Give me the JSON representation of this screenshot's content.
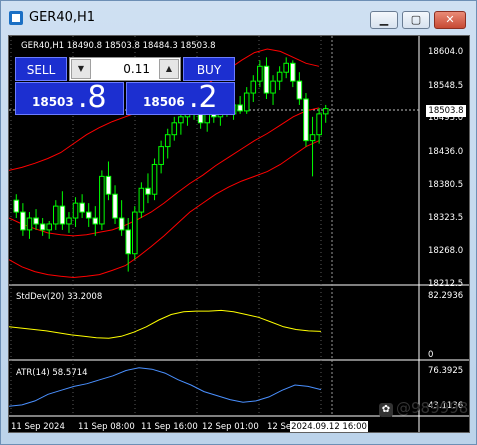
{
  "window": {
    "title": "GER40,H1",
    "minimize_icon": "minimize-icon",
    "restore_icon": "restore-icon",
    "close_icon": "close-icon"
  },
  "chart_header": "GER40,H1  18490.8 18503.8 18484.3 18503.8",
  "trading": {
    "sell_label": "SELL",
    "buy_label": "BUY",
    "lot": "0.11",
    "sell_price_main": "18503",
    "sell_price_big": ".8",
    "buy_price_main": "18506",
    "buy_price_big": ".2"
  },
  "price_axis": [
    "18604.0",
    "18548.5",
    "18493.0",
    "18436.0",
    "18380.5",
    "18323.5",
    "18268.0",
    "18212.5"
  ],
  "last_price": "18503.8",
  "stddev": {
    "label": "StdDev(20) 33.2008",
    "top": "82.2936",
    "bottom": "0"
  },
  "atr": {
    "label": "ATR(14) 58.5714",
    "top": "76.3925",
    "bottom": "43.1136"
  },
  "time_axis": [
    "11 Sep 2024",
    "11 Sep 08:00",
    "11 Sep 16:00",
    "12 Sep 01:00",
    "12 Se"
  ],
  "crosshair_time": "2024.09.12 16:00",
  "watermark": "@989998",
  "colors": {
    "candle": "#00ff00",
    "bands": "#ff0000",
    "stddev": "#ffff00",
    "atr": "#4a90ff",
    "panel_blue": "#1c2fd0"
  },
  "chart_data": [
    {
      "type": "candlestick",
      "title": "GER40,H1",
      "ylim": [
        18212.5,
        18604.0
      ],
      "candles": [
        [
          18350,
          18360,
          18320,
          18330
        ],
        [
          18330,
          18345,
          18290,
          18300
        ],
        [
          18300,
          18330,
          18285,
          18320
        ],
        [
          18320,
          18335,
          18300,
          18310
        ],
        [
          18310,
          18320,
          18290,
          18300
        ],
        [
          18300,
          18315,
          18285,
          18310
        ],
        [
          18310,
          18350,
          18300,
          18340
        ],
        [
          18340,
          18365,
          18300,
          18310
        ],
        [
          18310,
          18330,
          18295,
          18320
        ],
        [
          18320,
          18355,
          18305,
          18345
        ],
        [
          18345,
          18360,
          18320,
          18330
        ],
        [
          18330,
          18345,
          18305,
          18320
        ],
        [
          18320,
          18340,
          18290,
          18310
        ],
        [
          18310,
          18400,
          18300,
          18390
        ],
        [
          18390,
          18415,
          18350,
          18360
        ],
        [
          18360,
          18375,
          18310,
          18320
        ],
        [
          18320,
          18350,
          18290,
          18300
        ],
        [
          18300,
          18320,
          18230,
          18260
        ],
        [
          18260,
          18340,
          18250,
          18330
        ],
        [
          18330,
          18380,
          18320,
          18370
        ],
        [
          18370,
          18395,
          18345,
          18360
        ],
        [
          18360,
          18420,
          18350,
          18410
        ],
        [
          18410,
          18450,
          18395,
          18440
        ],
        [
          18440,
          18470,
          18420,
          18460
        ],
        [
          18460,
          18490,
          18450,
          18480
        ],
        [
          18480,
          18500,
          18460,
          18490
        ],
        [
          18490,
          18505,
          18475,
          18500
        ],
        [
          18500,
          18512,
          18485,
          18495
        ],
        [
          18495,
          18505,
          18470,
          18480
        ],
        [
          18480,
          18500,
          18465,
          18495
        ],
        [
          18495,
          18510,
          18480,
          18490
        ],
        [
          18490,
          18510,
          18475,
          18505
        ],
        [
          18505,
          18520,
          18490,
          18495
        ],
        [
          18495,
          18515,
          18485,
          18510
        ],
        [
          18510,
          18525,
          18495,
          18500
        ],
        [
          18500,
          18540,
          18495,
          18530
        ],
        [
          18530,
          18560,
          18515,
          18550
        ],
        [
          18550,
          18585,
          18540,
          18575
        ],
        [
          18575,
          18590,
          18520,
          18530
        ],
        [
          18530,
          18560,
          18510,
          18550
        ],
        [
          18550,
          18575,
          18535,
          18565
        ],
        [
          18565,
          18590,
          18555,
          18580
        ],
        [
          18580,
          18585,
          18540,
          18550
        ],
        [
          18550,
          18565,
          18510,
          18520
        ],
        [
          18520,
          18530,
          18440,
          18450
        ],
        [
          18450,
          18490,
          18390,
          18460
        ],
        [
          18460,
          18505,
          18445,
          18495
        ],
        [
          18495,
          18510,
          18480,
          18503.8
        ]
      ],
      "bands": {
        "upper": [
          18400,
          18405,
          18412,
          18420,
          18430,
          18445,
          18460,
          18472,
          18482,
          18490,
          18498,
          18505,
          18510,
          18518,
          18528,
          18540,
          18555,
          18570,
          18585,
          18598,
          18604,
          18600,
          18590,
          18580,
          18575
        ],
        "middle": [
          18320,
          18310,
          18302,
          18295,
          18292,
          18290,
          18292,
          18296,
          18300,
          18308,
          18318,
          18330,
          18345,
          18362,
          18378,
          18392,
          18408,
          18422,
          18436,
          18450,
          18462,
          18476,
          18490,
          18500,
          18505
        ],
        "lower": [
          18250,
          18238,
          18230,
          18225,
          18222,
          18220,
          18222,
          18225,
          18232,
          18240,
          18255,
          18272,
          18290,
          18310,
          18330,
          18345,
          18360,
          18372,
          18382,
          18390,
          18398,
          18410,
          18425,
          18440,
          18450
        ]
      }
    },
    {
      "type": "line",
      "title": "StdDev(20) 33.2008",
      "ylim": [
        0,
        82.2936
      ],
      "series": [
        {
          "name": "StdDev(20)",
          "values": [
            40,
            38,
            36,
            34,
            31,
            28,
            26,
            24,
            23,
            26,
            32,
            40,
            50,
            58,
            62,
            63,
            63,
            64,
            62,
            58,
            54,
            47,
            40,
            36,
            34,
            33.2
          ]
        }
      ]
    },
    {
      "type": "line",
      "title": "ATR(14) 58.5714",
      "ylim": [
        43.1136,
        76.3925
      ],
      "series": [
        {
          "name": "ATR(14)",
          "values": [
            46,
            47,
            50,
            55,
            58,
            61,
            63,
            66,
            69,
            73,
            75,
            74,
            71,
            66,
            62,
            57,
            54,
            51,
            49,
            50,
            53,
            58,
            62,
            61,
            58.5714
          ]
        }
      ]
    }
  ]
}
